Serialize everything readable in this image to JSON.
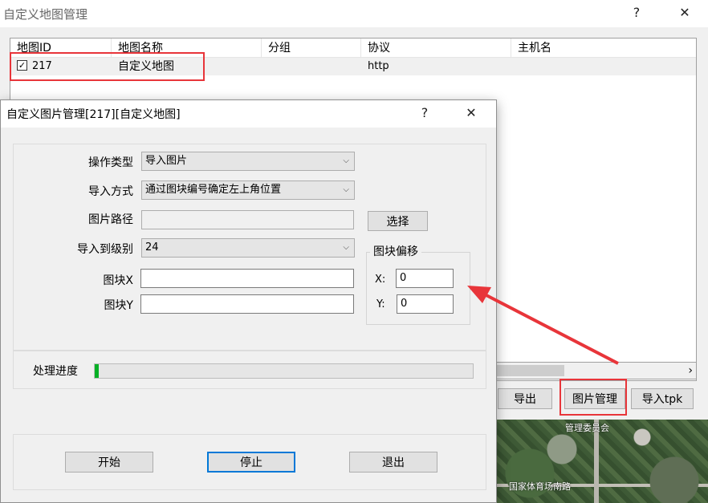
{
  "main_window": {
    "title": "自定义地图管理",
    "help": "?",
    "close": "✕",
    "columns": [
      "地图ID",
      "地图名称",
      "分组",
      "协议",
      "主机名"
    ],
    "rows": [
      {
        "checked": true,
        "id": "217",
        "name": "自定义地图",
        "group": "",
        "protocol": "http",
        "host": ""
      }
    ],
    "buttons": {
      "export": "导出",
      "image_manage": "图片管理",
      "import_tpk": "导入tpk"
    }
  },
  "dialog": {
    "title": "自定义图片管理[217][自定义地图]",
    "help": "?",
    "close": "✕",
    "operation_type_label": "操作类型",
    "operation_type_value": "导入图片",
    "import_method_label": "导入方式",
    "import_method_value": "通过图块编号确定左上角位置",
    "image_path_label": "图片路径",
    "image_path_value": "",
    "select_button": "选择",
    "import_level_label": "导入到级别",
    "import_level_value": "24",
    "tile_x_label": "图块X",
    "tile_x_value": "",
    "tile_y_label": "图块Y",
    "tile_y_value": "",
    "tile_offset_title": "图块偏移",
    "offset_x_label": "X:",
    "offset_x_value": "0",
    "offset_y_label": "Y:",
    "offset_y_value": "0",
    "progress_label": "处理进度",
    "progress_fraction": 0.01,
    "start_button": "开始",
    "stop_button": "停止",
    "exit_button": "退出"
  },
  "map_labels": [
    "管理委员会",
    "国家体育场南路"
  ],
  "colors": {
    "highlight_red": "#e8353a",
    "progress_green": "#06b025",
    "focus_blue": "#0078d7"
  }
}
